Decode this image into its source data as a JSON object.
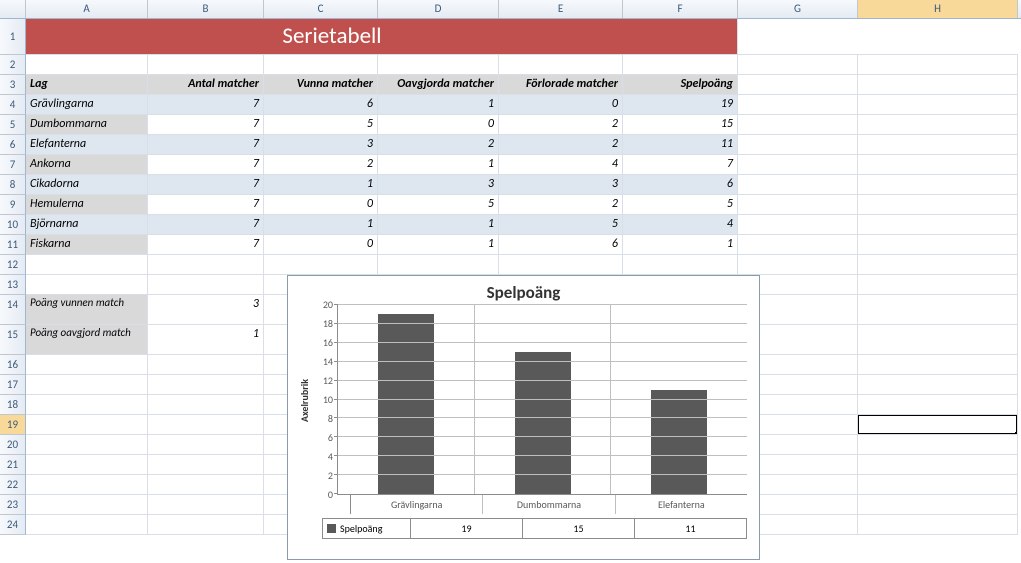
{
  "columns": [
    "A",
    "B",
    "C",
    "D",
    "E",
    "F",
    "G",
    "H"
  ],
  "title": "Serietabell",
  "headers": {
    "lag": "Lag",
    "antal": "Antal matcher",
    "vunna": "Vunna matcher",
    "oavgjorda": "Oavgjorda matcher",
    "forlorade": "Förlorade matcher",
    "spelpoang": "Spelpoäng"
  },
  "rows": [
    {
      "lag": "Grävlingarna",
      "antal": 7,
      "vunna": 6,
      "oavgjorda": 1,
      "forlorade": 0,
      "spel": 19
    },
    {
      "lag": "Dumbommarna",
      "antal": 7,
      "vunna": 5,
      "oavgjorda": 0,
      "forlorade": 2,
      "spel": 15
    },
    {
      "lag": "Elefanterna",
      "antal": 7,
      "vunna": 3,
      "oavgjorda": 2,
      "forlorade": 2,
      "spel": 11
    },
    {
      "lag": "Ankorna",
      "antal": 7,
      "vunna": 2,
      "oavgjorda": 1,
      "forlorade": 4,
      "spel": 7
    },
    {
      "lag": "Cikadorna",
      "antal": 7,
      "vunna": 1,
      "oavgjorda": 3,
      "forlorade": 3,
      "spel": 6
    },
    {
      "lag": "Hemulerna",
      "antal": 7,
      "vunna": 0,
      "oavgjorda": 5,
      "forlorade": 2,
      "spel": 5
    },
    {
      "lag": "Björnarna",
      "antal": 7,
      "vunna": 1,
      "oavgjorda": 1,
      "forlorade": 5,
      "spel": 4
    },
    {
      "lag": "Fiskarna",
      "antal": 7,
      "vunna": 0,
      "oavgjorda": 1,
      "forlorade": 6,
      "spel": 1
    }
  ],
  "points": {
    "vunnen_label": "Poäng vunnen match",
    "vunnen_val": 3,
    "oavgjord_label": "Poäng oavgjord match",
    "oavgjord_val": 1
  },
  "selected_cell": "H19",
  "chart_data": {
    "type": "bar",
    "title": "Spelpoäng",
    "ylabel": "Axelrubrik",
    "ylim": [
      0,
      20
    ],
    "yticks": [
      20,
      18,
      16,
      14,
      12,
      10,
      8,
      6,
      4,
      2,
      0
    ],
    "series_name": "Spelpoäng",
    "categories": [
      "Grävlingarna",
      "Dumbommarna",
      "Elefanterna"
    ],
    "values": [
      19,
      15,
      11
    ]
  }
}
